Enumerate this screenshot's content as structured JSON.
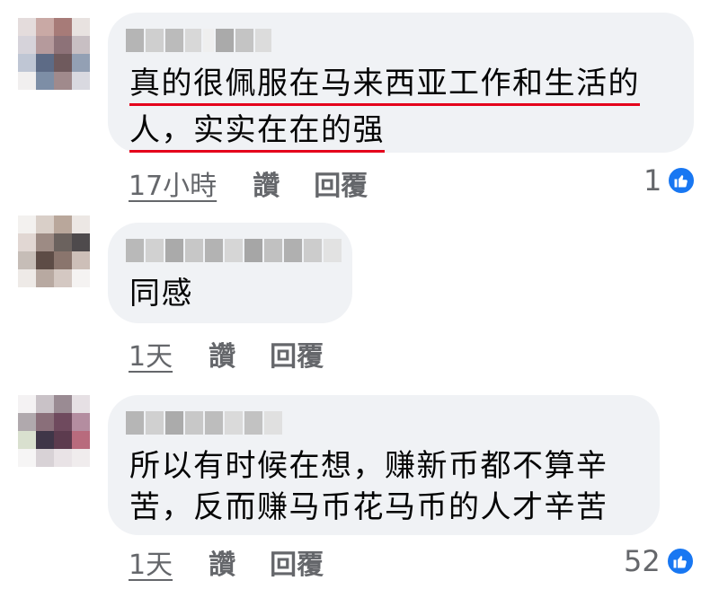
{
  "comments": [
    {
      "text_lines": [
        "真的很佩服在马来西亚工作和生活的",
        "人，实实在在的强"
      ],
      "time": "17小時",
      "like_label": "讚",
      "reply_label": "回覆",
      "reaction_count": "1"
    },
    {
      "text_lines": [
        "同感"
      ],
      "time": "1天",
      "like_label": "讚",
      "reply_label": "回覆",
      "reaction_count": ""
    },
    {
      "text_lines": [
        "所以有时候在想，赚新币都不算辛",
        "苦，反而赚马币花马币的人才辛苦"
      ],
      "time": "1天",
      "like_label": "讚",
      "reply_label": "回覆",
      "reaction_count": "52"
    }
  ],
  "colors": {
    "bubble": "#f0f2f5",
    "underline": "#e4001b",
    "like_blue": "#1877f2",
    "meta_gray": "#65676b"
  },
  "icons": {
    "reaction": "thumbs-up-icon"
  }
}
